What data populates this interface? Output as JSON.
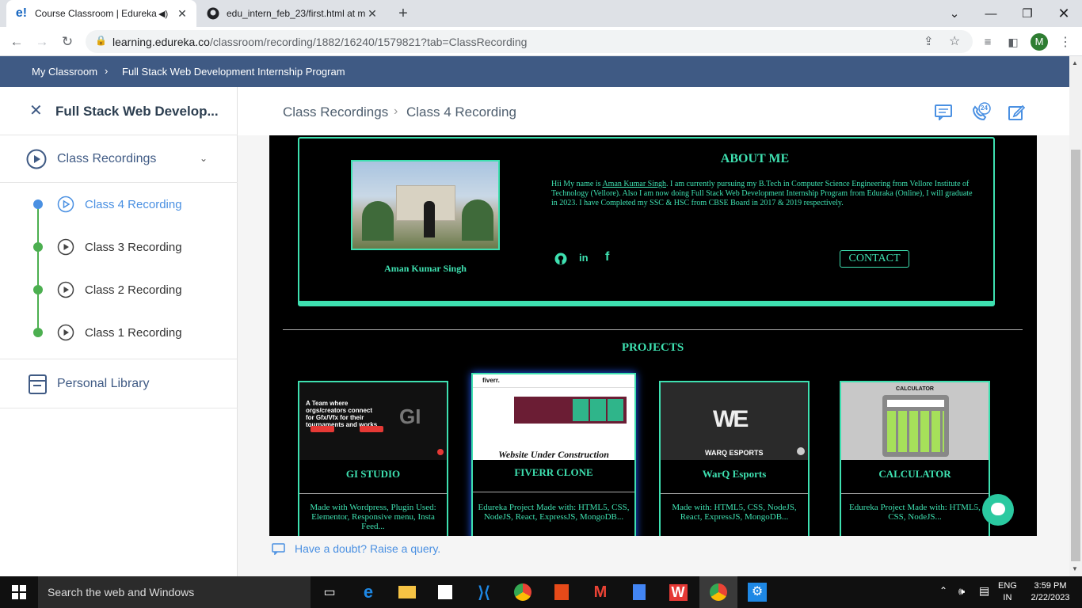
{
  "browser": {
    "tabs": [
      {
        "favicon": "e!",
        "title": "Course Classroom | Edureka"
      },
      {
        "favicon": "github-icon",
        "title": "edu_intern_feb_23/first.html at m"
      }
    ],
    "url_host": "learning.edureka.co",
    "url_path": "/classroom/recording/1882/16240/1579821?tab=ClassRecording",
    "profile_initial": "M"
  },
  "breadcrumb": {
    "root": "My Classroom",
    "current": "Full Stack Web Development Internship Program"
  },
  "sidebar": {
    "course_title": "Full Stack Web Develop...",
    "section_label": "Class Recordings",
    "recordings": [
      "Class 4 Recording",
      "Class 3 Recording",
      "Class 2 Recording",
      "Class 1 Recording"
    ],
    "personal_library": "Personal Library"
  },
  "header": {
    "crumb_parent": "Class Recordings",
    "crumb_current": "Class 4 Recording",
    "badge_24": "24"
  },
  "video": {
    "about_title": "ABOUT ME",
    "name": "Aman Kumar Singh",
    "about_pre": "Hii My name is ",
    "about_link": "Aman Kumar Singh",
    "about_post": ". I am currently pursuing my B.Tech in Computer Science Engineering from Vellore Institute of Technology (Vellore). Also I am now doing Full Stack Web Development Internship Program from Eduraka (Online), I will graduate in 2023. I have Completed my SSC & HSC from CBSE Board in 2017 & 2019 respectively.",
    "contact": "CONTACT",
    "projects_title": "PROJECTS",
    "projects": [
      {
        "name": "GI STUDIO",
        "desc": "Made with Wordpress, Plugin Used: Elementor, Responsive menu, Insta Feed...",
        "shot_text": "A Team where orgs/creators connect for Gfx/Vfx for their tournaments and works"
      },
      {
        "name": "FIVERR CLONE",
        "desc": "Edureka Project Made with: HTML5, CSS, NodeJS, React, ExpressJS, MongoDB...",
        "shot_text": "Website Under Construction",
        "shot_brand": "fiverr."
      },
      {
        "name": "WarQ Esports",
        "desc": "Made with: HTML5, CSS, NodeJS, React, ExpressJS, MongoDB...",
        "shot_text": "WARQ ESPORTS"
      },
      {
        "name": "CALCULATOR",
        "desc": "Edureka Project Made with: HTML5, CSS, NodeJS...",
        "shot_text": "CALCULATOR"
      }
    ]
  },
  "doubt": "Have a doubt? Raise a query.",
  "taskbar": {
    "search_placeholder": "Search the web and Windows",
    "lang_top": "ENG",
    "lang_bottom": "IN",
    "time": "3:59 PM",
    "date": "2/22/2023"
  },
  "colors": {
    "brand_blue": "#3f5a84",
    "accent_teal": "#3ee0b0",
    "link_blue": "#4a90e2",
    "done_green": "#4caf50"
  }
}
